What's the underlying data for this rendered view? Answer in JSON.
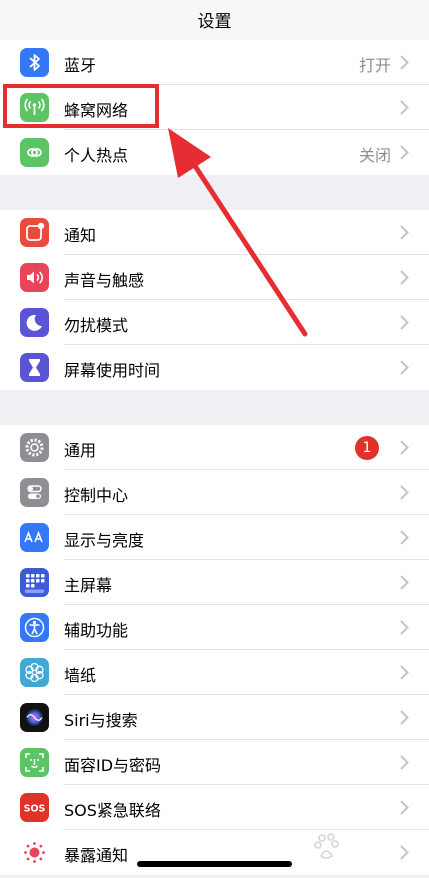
{
  "nav": {
    "title": "设置"
  },
  "group1": [
    {
      "label": "蓝牙",
      "value": "打开",
      "icon": "bluetooth-icon",
      "color": "#3478f6"
    },
    {
      "label": "蜂窝网络",
      "value": "",
      "icon": "cellular-icon",
      "color": "#5dc466"
    },
    {
      "label": "个人热点",
      "value": "关闭",
      "icon": "hotspot-icon",
      "color": "#5dc466"
    }
  ],
  "group2": [
    {
      "label": "通知",
      "icon": "notifications-icon",
      "color": "#ea4b3d"
    },
    {
      "label": "声音与触感",
      "icon": "sound-icon",
      "color": "#e9455a"
    },
    {
      "label": "勿扰模式",
      "icon": "moon-icon",
      "color": "#5b55d6"
    },
    {
      "label": "屏幕使用时间",
      "icon": "hourglass-icon",
      "color": "#5b55d6"
    }
  ],
  "group3": [
    {
      "label": "通用",
      "badge": "1",
      "icon": "gear-icon",
      "color": "#8e8e93"
    },
    {
      "label": "控制中心",
      "icon": "control-center-icon",
      "color": "#8e8e93"
    },
    {
      "label": "显示与亮度",
      "icon": "display-icon",
      "color": "#3478f6"
    },
    {
      "label": "主屏幕",
      "icon": "home-screen-icon",
      "color": "#3d5bd8"
    },
    {
      "label": "辅助功能",
      "icon": "accessibility-icon",
      "color": "#3478f6"
    },
    {
      "label": "墙纸",
      "icon": "wallpaper-icon",
      "color": "#42a8d4"
    },
    {
      "label": "Siri与搜索",
      "icon": "siri-icon",
      "color": "#222"
    },
    {
      "label": "面容ID与密码",
      "icon": "face-id-icon",
      "color": "#5dc466"
    },
    {
      "label": "SOS紧急联络",
      "icon": "sos-icon",
      "color": "#e0322a"
    },
    {
      "label": "暴露通知",
      "icon": "exposure-icon",
      "color": "#ffffff"
    }
  ],
  "colors": {
    "highlight": "#e62d34",
    "badge": "#e0322a"
  }
}
